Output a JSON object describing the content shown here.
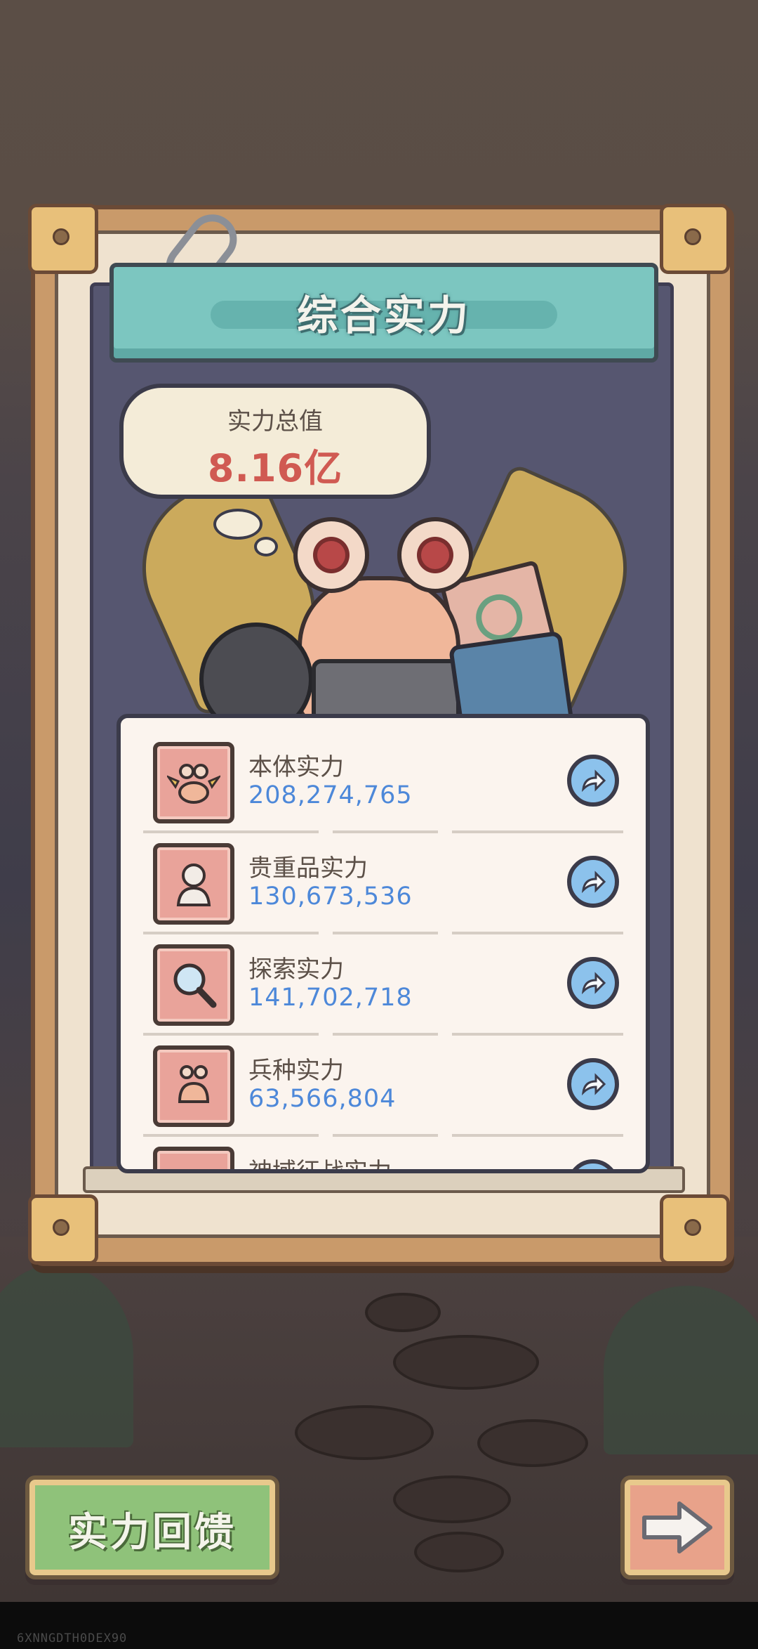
{
  "panel": {
    "title": "综合实力"
  },
  "total": {
    "label": "实力总值",
    "value": "8.16亿"
  },
  "items": [
    {
      "name": "本体实力",
      "value": "208,274,765",
      "icon": "winged-snail-icon"
    },
    {
      "name": "贵重品实力",
      "value": "130,673,536",
      "icon": "bust-statue-icon"
    },
    {
      "name": "探索实力",
      "value": "141,702,718",
      "icon": "magnifier-icon"
    },
    {
      "name": "兵种实力",
      "value": "63,566,804",
      "icon": "bug-soldier-icon"
    },
    {
      "name": "神域征战实力",
      "value": "",
      "icon": "partial-item-icon"
    }
  ],
  "buttons": {
    "feedback": "实力回馈",
    "next_icon": "arrow-right-icon",
    "detail_icon": "share-arrow-icon"
  },
  "watermark": "6XNNGDTH0DEX90",
  "colors": {
    "value_blue": "#4d88d9",
    "total_red": "#d05a52",
    "banner_teal": "#7cc6c0"
  }
}
